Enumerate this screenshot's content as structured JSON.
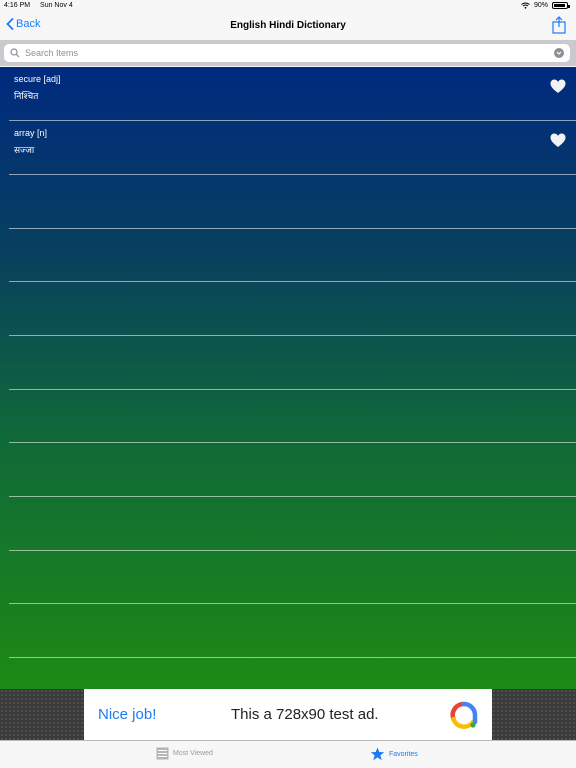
{
  "status": {
    "time": "4:16 PM",
    "date": "Sun Nov 4",
    "battery": "90%"
  },
  "nav": {
    "back_label": "Back",
    "title": "English Hindi Dictionary"
  },
  "search": {
    "placeholder": "Search Items"
  },
  "entries": [
    {
      "english": "secure [adj]",
      "hindi": "निश्चित"
    },
    {
      "english": "array [n]",
      "hindi": "सज्जा"
    }
  ],
  "ad": {
    "headline": "Nice job!",
    "text": "This a 728x90 test ad."
  },
  "tabs": {
    "most_viewed": "Most Viewed",
    "favorites": "Favorites"
  },
  "colors": {
    "accent": "#1a7cf5",
    "gradient_top": "#002a7f",
    "gradient_bottom": "#1d8a14"
  }
}
